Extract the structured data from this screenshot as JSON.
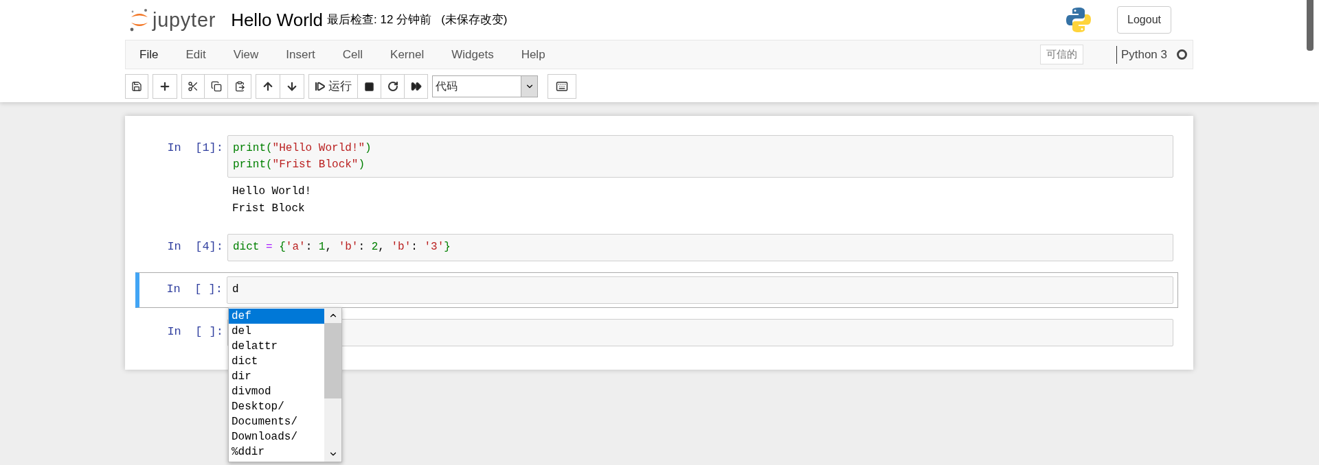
{
  "header": {
    "logo_text": "jupyter",
    "notebook_name": "Hello World",
    "checkpoint": "最后检查: 12 分钟前",
    "autosave_status": "(未保存改变)",
    "logout": "Logout"
  },
  "menubar": {
    "items": [
      {
        "label": "File"
      },
      {
        "label": "Edit"
      },
      {
        "label": "View"
      },
      {
        "label": "Insert"
      },
      {
        "label": "Cell"
      },
      {
        "label": "Kernel"
      },
      {
        "label": "Widgets"
      },
      {
        "label": "Help"
      }
    ],
    "trusted": "可信的",
    "kernel_name": "Python 3",
    "kernel_busy": false
  },
  "toolbar": {
    "run_label": "运行",
    "cell_type": "代码"
  },
  "cells": [
    {
      "prompt": "In  [1]:",
      "selected": false,
      "lines": [
        [
          {
            "text": "print(",
            "kind": "builtin"
          },
          {
            "text": "\"Hello World!\"",
            "kind": "string"
          },
          {
            "text": ")",
            "kind": "builtin"
          }
        ],
        [
          {
            "text": "print(",
            "kind": "builtin"
          },
          {
            "text": "\"Frist Block\"",
            "kind": "string"
          },
          {
            "text": ")",
            "kind": "builtin"
          }
        ]
      ],
      "output": [
        "Hello World!",
        "Frist Block"
      ]
    },
    {
      "prompt": "In  [4]:",
      "selected": false,
      "lines": [
        [
          {
            "text": "dict",
            "kind": "builtin"
          },
          {
            "text": " = ",
            "kind": "operator"
          },
          {
            "text": "{",
            "kind": "builtin"
          },
          {
            "text": "'a'",
            "kind": "string"
          },
          {
            "text": ": ",
            "kind": "plain"
          },
          {
            "text": "1",
            "kind": "number"
          },
          {
            "text": ", ",
            "kind": "plain"
          },
          {
            "text": "'b'",
            "kind": "string"
          },
          {
            "text": ": ",
            "kind": "plain"
          },
          {
            "text": "2",
            "kind": "number"
          },
          {
            "text": ", ",
            "kind": "plain"
          },
          {
            "text": "'b'",
            "kind": "string"
          },
          {
            "text": ": ",
            "kind": "plain"
          },
          {
            "text": "'3'",
            "kind": "string"
          },
          {
            "text": "}",
            "kind": "builtin"
          }
        ]
      ]
    },
    {
      "prompt": "In  [ ]:",
      "selected": true,
      "lines": [
        [
          {
            "text": "d",
            "kind": "plain"
          }
        ]
      ]
    },
    {
      "prompt": "In  [ ]:",
      "selected": false
    }
  ],
  "completions": [
    {
      "label": "def",
      "selected": true
    },
    {
      "label": "del",
      "selected": false
    },
    {
      "label": "delattr",
      "selected": false
    },
    {
      "label": "dict",
      "selected": false
    },
    {
      "label": "dir",
      "selected": false
    },
    {
      "label": "divmod",
      "selected": false
    },
    {
      "label": "Desktop/",
      "selected": false
    },
    {
      "label": "Documents/",
      "selected": false
    },
    {
      "label": "Downloads/",
      "selected": false
    },
    {
      "label": "%ddir",
      "selected": false
    }
  ]
}
